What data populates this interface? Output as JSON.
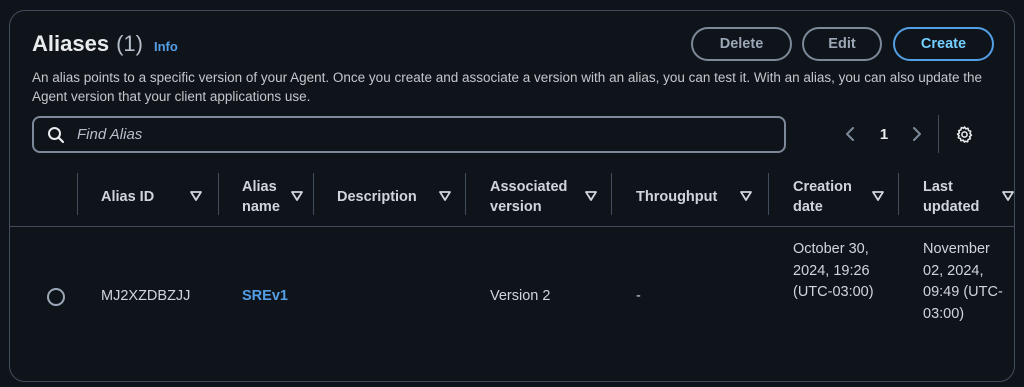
{
  "header": {
    "title": "Aliases",
    "count": "(1)",
    "info_link": "Info",
    "description": "An alias points to a specific version of your Agent. Once you create and associate a version with an alias, you can test it. With an alias, you can also update the Agent version that your client applications use."
  },
  "actions": {
    "delete_label": "Delete",
    "edit_label": "Edit",
    "create_label": "Create"
  },
  "search": {
    "placeholder": "Find Alias",
    "value": ""
  },
  "pagination": {
    "current_page": "1"
  },
  "table": {
    "columns": [
      "Alias ID",
      "Alias name",
      "Description",
      "Associated version",
      "Throughput",
      "Creation date",
      "Last updated"
    ],
    "rows": [
      {
        "alias_id": "MJ2XZDBZJJ",
        "alias_name": "SREv1",
        "description": "",
        "associated_version": "Version 2",
        "throughput": "-",
        "creation_date": "October 30, 2024, 19:26 (UTC-03:00)",
        "last_updated": "November 02, 2024, 09:49 (UTC-03:00)"
      }
    ]
  },
  "colors": {
    "background": "#0f141b",
    "border": "#414d5c",
    "accent": "#539fe5",
    "text": "#d1d5db"
  }
}
